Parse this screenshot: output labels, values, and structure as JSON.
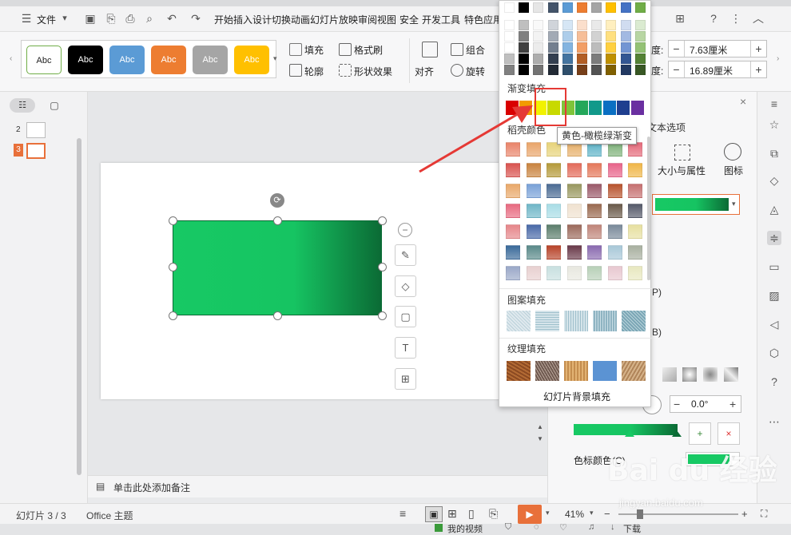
{
  "menubar": {
    "file_label": "文件",
    "tabs": [
      "开始",
      "插入",
      "设计",
      "切换",
      "动画",
      "幻灯片放映",
      "审阅",
      "视图",
      "安全",
      "开发工具",
      "特色应用"
    ]
  },
  "ribbon": {
    "style_buttons": [
      "Abc",
      "Abc",
      "Abc",
      "Abc",
      "Abc",
      "Abc"
    ],
    "fill_label": "填充",
    "format_brush_label": "格式刷",
    "outline_label": "轮廓",
    "shape_effect_label": "形状效果",
    "align_label": "对齐",
    "group_label": "组合",
    "rotate_label": "旋转",
    "height_label": "度:",
    "height_value": "7.63厘米",
    "width_label": "度:",
    "width_value": "16.89厘米"
  },
  "slides": {
    "numbers": [
      "2",
      "3"
    ],
    "active": "3"
  },
  "notes": {
    "placeholder": "单击此处添加备注"
  },
  "status": {
    "slide_counter": "幻灯片 3 / 3",
    "theme": "Office 主题",
    "zoom": "41%"
  },
  "taskbar": {
    "my_video": "我的视频",
    "download": "下载"
  },
  "rightpane": {
    "text_options": "文本选项",
    "size_props": "大小与属性",
    "icon_label": "图标",
    "angle_value": "0.0°",
    "color_stop_label": "色标颜色(C)",
    "label_p": "P)",
    "label_b": "B)"
  },
  "dropdown": {
    "gradient_title": "渐变填充",
    "shell_title": "稻壳颜色",
    "pattern_title": "图案填充",
    "texture_title": "纹理填充",
    "slide_bg_fill": "幻灯片背景填充",
    "tooltip": "黄色-橄榄绿渐变",
    "gradient_colors": [
      "#d90000",
      "#f29b00",
      "#f2f200",
      "#c8d900",
      "#7fc43a",
      "#23a75a",
      "#12998a",
      "#0a6fc2",
      "#1f3f8f",
      "#6a2fa0"
    ],
    "theme_top_row": [
      "#ffffff",
      "#000000",
      "#e6e6e6",
      "#44546a",
      "#5b9bd5",
      "#ed7d31",
      "#a5a5a5",
      "#ffc000",
      "#4472c4",
      "#70ad47"
    ]
  },
  "watermark": {
    "text": "Bai du 经验",
    "sub": "jingyan.baidu.com"
  }
}
